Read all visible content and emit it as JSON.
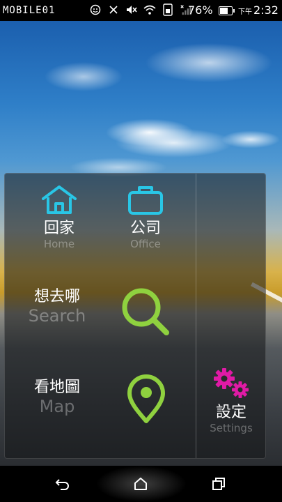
{
  "status_bar": {
    "brand": "MOBILE01",
    "battery_percent": "76%",
    "battery_level": 0.76,
    "time_prefix": "下午",
    "time": "2:32",
    "icons": [
      "smiley-icon",
      "nfc-icon",
      "mute-icon",
      "wifi-icon",
      "sim-icon",
      "signal-icon",
      "battery-icon"
    ]
  },
  "shortcuts": {
    "home": {
      "label": "回家",
      "sub": "Home",
      "icon": "home-icon",
      "color": "#29c6e6"
    },
    "office": {
      "label": "公司",
      "sub": "Office",
      "icon": "briefcase-icon",
      "color": "#29c6e6"
    },
    "search": {
      "label": "想去哪",
      "sub": "Search",
      "icon": "search-icon",
      "color": "#8fd13f"
    },
    "map": {
      "label": "看地圖",
      "sub": "Map",
      "icon": "location-pin-icon",
      "color": "#8fd13f"
    },
    "settings": {
      "label": "設定",
      "sub": "Settings",
      "icon": "gears-icon",
      "color": "#e01aa6"
    }
  },
  "navigation": {
    "buttons": [
      "back-icon",
      "home-icon",
      "recent-apps-icon"
    ]
  }
}
